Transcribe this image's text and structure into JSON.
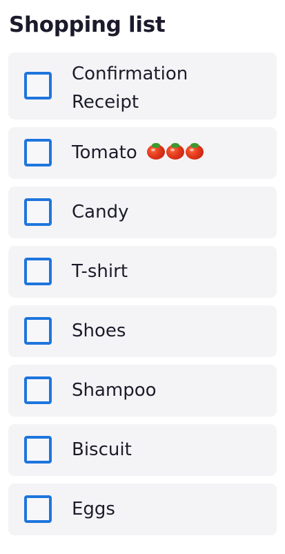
{
  "title": "Shopping list",
  "colors": {
    "accent": "#1e75dd",
    "item_background": "#f4f4f6",
    "text": "#1c1b2b"
  },
  "items": [
    {
      "label": "Confirmation Receipt",
      "checked": false
    },
    {
      "label": "Tomato",
      "emoji": "tomato x3",
      "checked": false
    },
    {
      "label": "Candy",
      "checked": false
    },
    {
      "label": "T-shirt",
      "checked": false
    },
    {
      "label": "Shoes",
      "checked": false
    },
    {
      "label": "Shampoo",
      "checked": false
    },
    {
      "label": "Biscuit",
      "checked": false
    },
    {
      "label": "Eggs",
      "checked": false
    }
  ]
}
